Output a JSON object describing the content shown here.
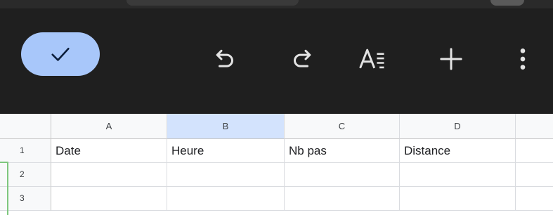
{
  "toolbar": {
    "done_icon": "checkmark-icon",
    "undo_icon": "undo-icon",
    "redo_icon": "redo-icon",
    "format_icon": "text-format-icon",
    "insert_icon": "plus-icon",
    "more_icon": "more-vert-icon",
    "done_bg": "#a8c7fa",
    "bar_bg": "#1f1f1f"
  },
  "sheet": {
    "columns": [
      "A",
      "B",
      "C",
      "D"
    ],
    "selected_column": "B",
    "rows": [
      {
        "num": "1",
        "cells": [
          "Date",
          "Heure",
          "Nb pas",
          "Distance"
        ]
      },
      {
        "num": "2",
        "cells": [
          "",
          "",
          "",
          ""
        ]
      },
      {
        "num": "3",
        "cells": [
          "",
          "",
          "",
          ""
        ]
      }
    ],
    "selected_color": "#d3e3fd"
  }
}
